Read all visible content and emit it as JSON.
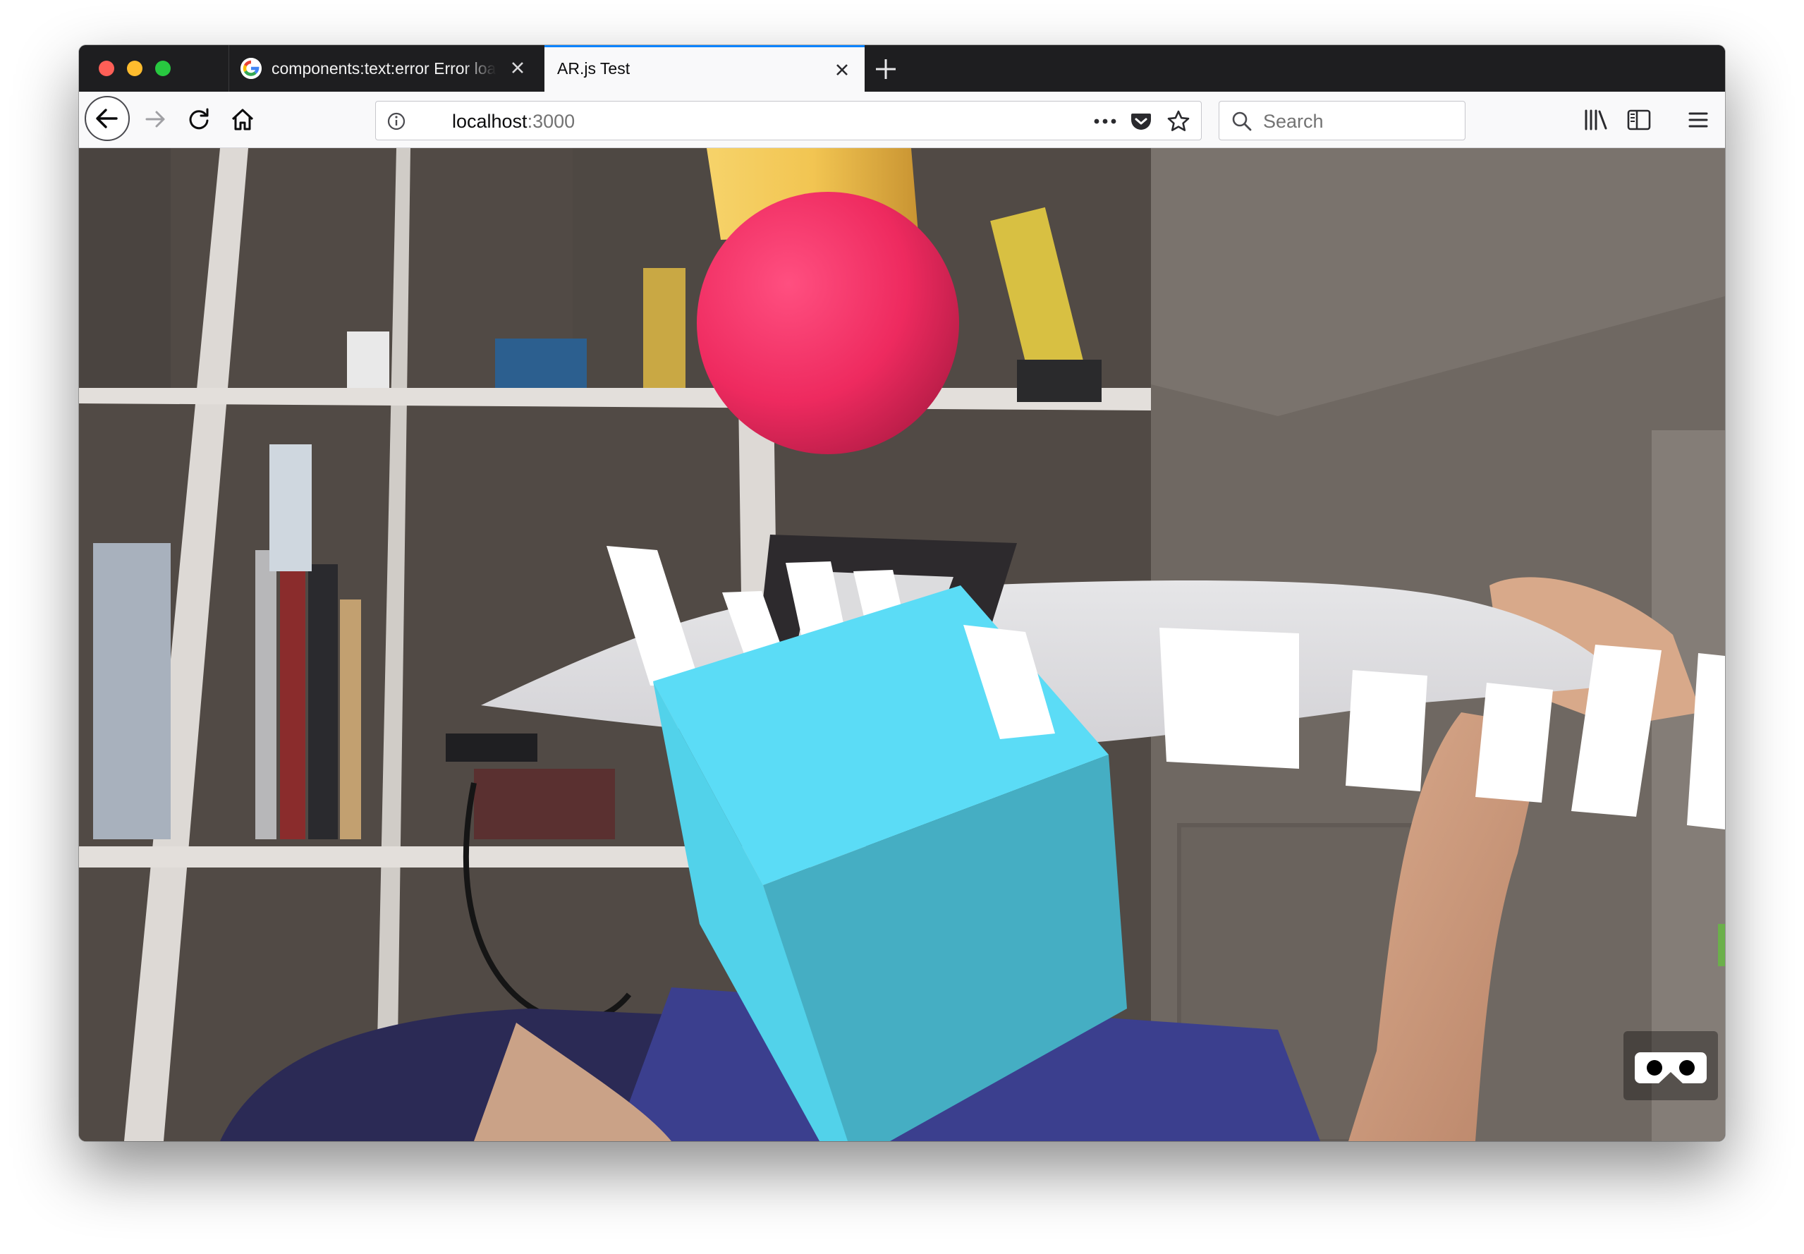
{
  "browser": {
    "tabs": [
      {
        "title": "components:text:error Error loa",
        "favicon": "google-g-icon",
        "active": false
      },
      {
        "title": "AR.js Test",
        "active": true
      }
    ],
    "url": {
      "host": "localhost",
      "port": ":3000"
    },
    "search": {
      "placeholder": "Search"
    },
    "colors": {
      "accent": "#0a84ff",
      "tabstrip": "#1e1e20",
      "toolbar": "#f9f9fa"
    }
  },
  "scene": {
    "objects": [
      "camera-feed",
      "yellow-cylinder",
      "pink-sphere",
      "cyan-cube",
      "white-bars",
      "vr-mode-button"
    ],
    "colors": {
      "sphere": "#f0285e",
      "cube_top": "#5ce0f6",
      "cube_side": "#45aec3",
      "cylinder": "#f0c350"
    }
  }
}
